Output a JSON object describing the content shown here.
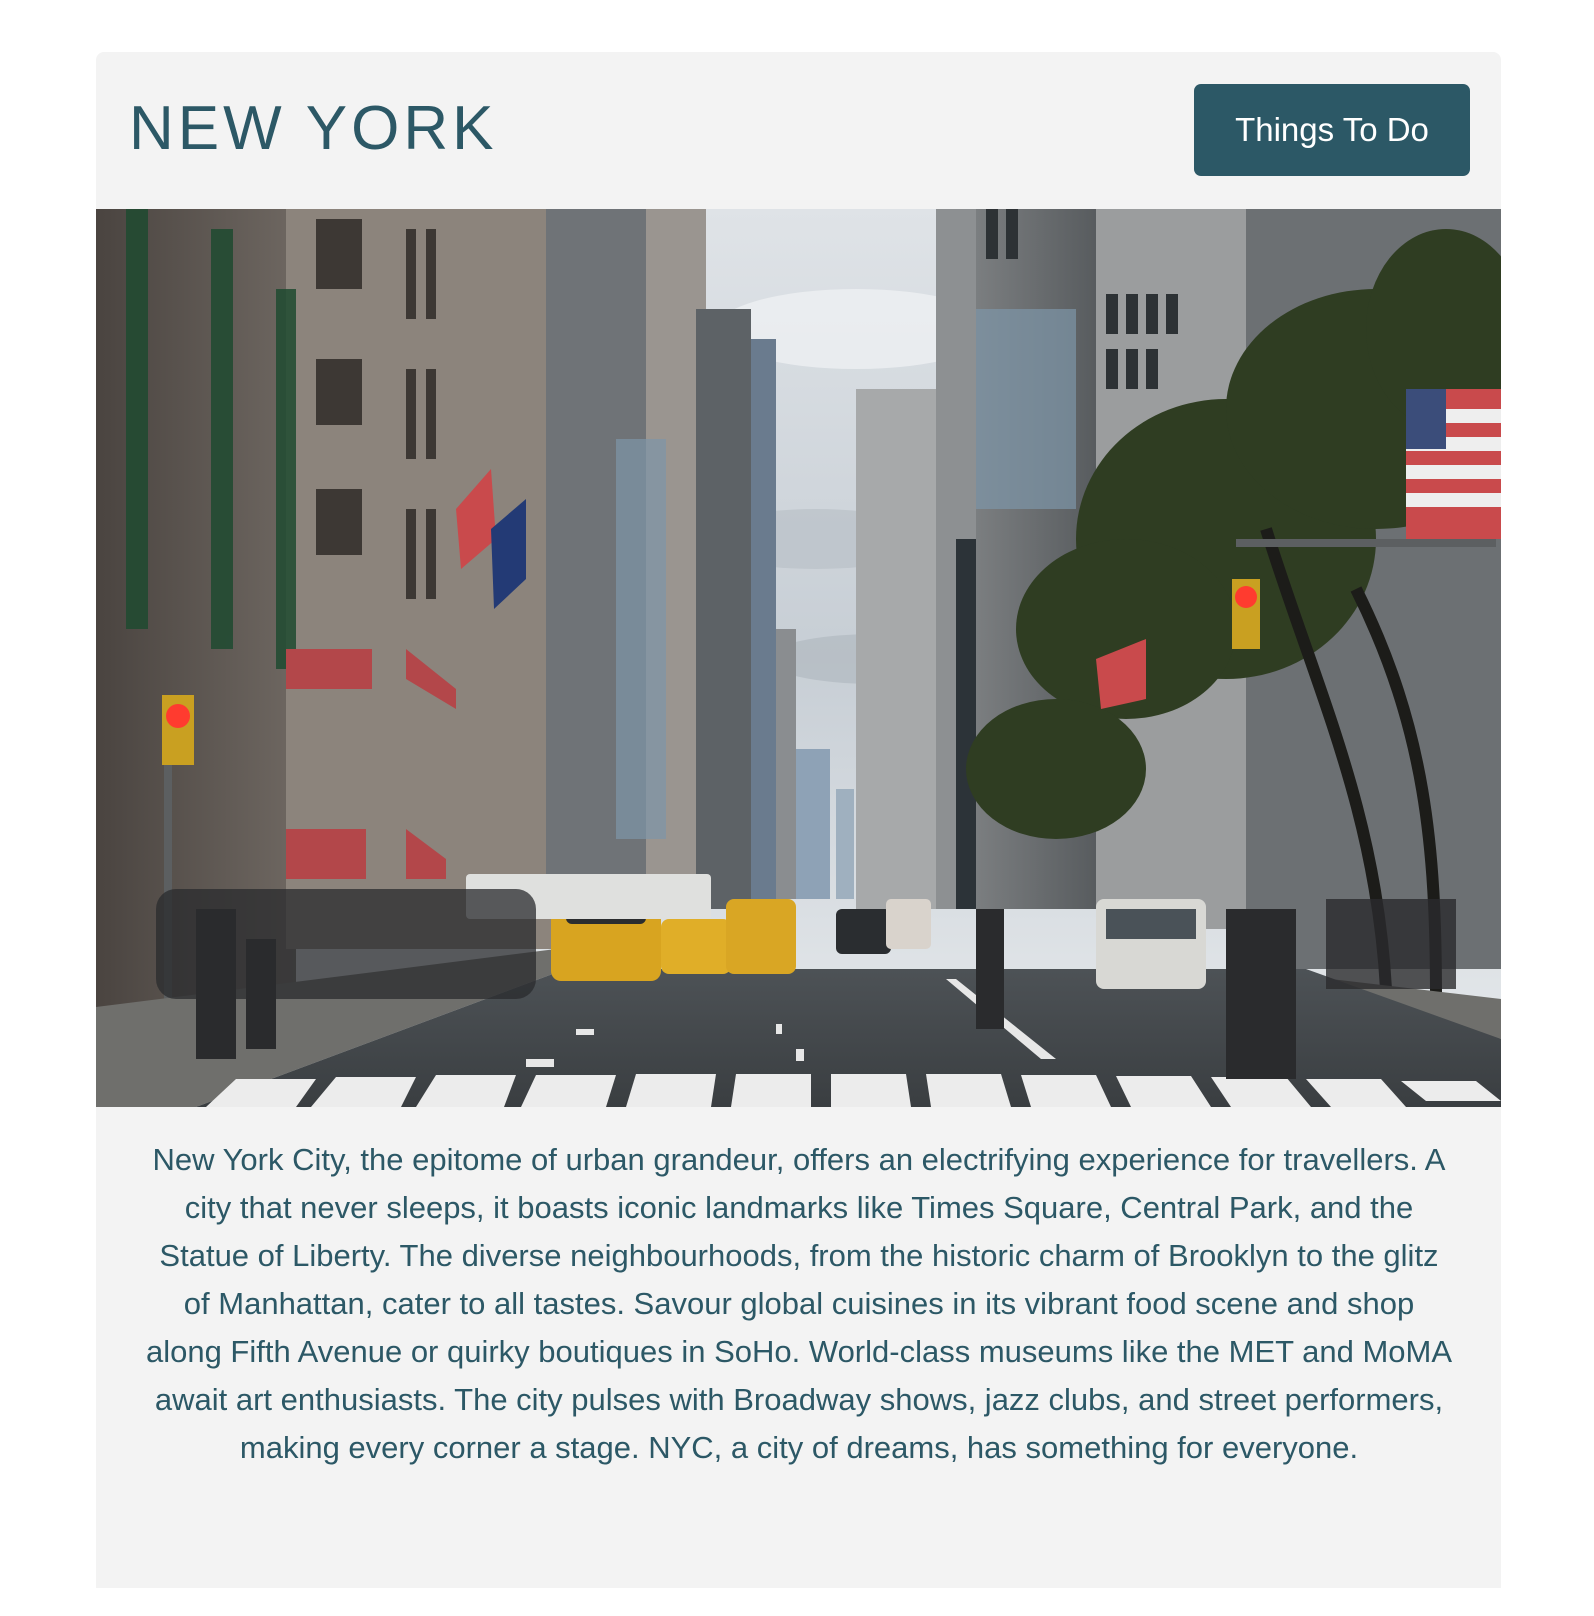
{
  "header": {
    "title": "NEW YORK",
    "cta_label": "Things To Do"
  },
  "hero_image": {
    "alt": "Busy New York avenue with yellow taxis, pedestrians on a crosswalk, American flags and skyscrapers"
  },
  "description": "New York City, the epitome of urban grandeur, offers an electrifying experience for travellers. A city that never sleeps, it boasts iconic landmarks like Times Square, Central Park, and the Statue of Liberty. The diverse neighbourhoods, from the historic charm of Brooklyn to the glitz of Manhattan, cater to all tastes. Savour global cuisines in its vibrant food scene and shop along Fifth Avenue or quirky boutiques in SoHo. World-class museums like the MET and MoMA await art enthusiasts. The city pulses with Broadway shows, jazz clubs, and street performers, making every corner a stage. NYC, a city of dreams, has something for everyone.",
  "colors": {
    "accent": "#2c5866",
    "card_background": "#f3f3f3",
    "page_background": "#ffffff"
  }
}
